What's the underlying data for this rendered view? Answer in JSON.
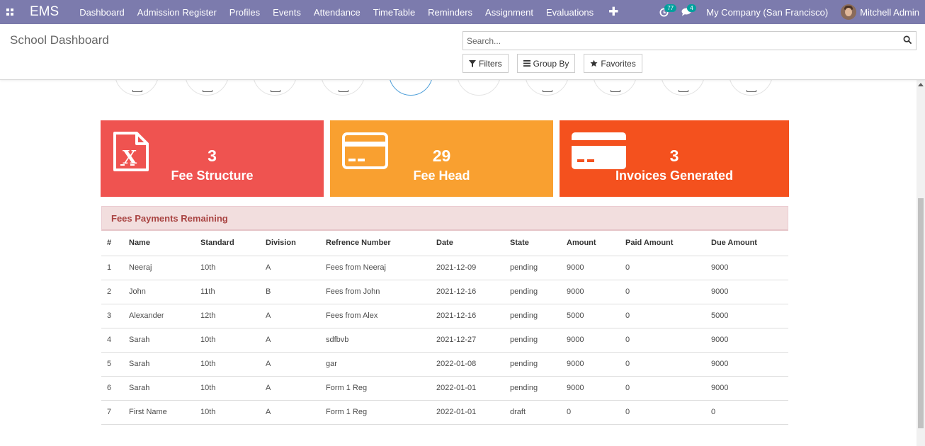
{
  "navbar": {
    "brand": "EMS",
    "menu": [
      "Dashboard",
      "Admission Register",
      "Profiles",
      "Events",
      "Attendance",
      "TimeTable",
      "Reminders",
      "Assignment",
      "Evaluations"
    ],
    "activity_count": "77",
    "message_count": "4",
    "company": "My Company (San Francisco)",
    "user": "Mitchell Admin"
  },
  "control": {
    "title": "School Dashboard",
    "search_placeholder": "Search...",
    "filters_label": "Filters",
    "group_by_label": "Group By",
    "favorites_label": "Favorites"
  },
  "cards": [
    {
      "value": "3",
      "label": "Fee Structure",
      "color": "#ef5350",
      "icon": "file-excel-icon"
    },
    {
      "value": "29",
      "label": "Fee Head",
      "color": "#f9a030",
      "icon": "credit-card-outline-icon"
    },
    {
      "value": "3",
      "label": "Invoices Generated",
      "color": "#f4511e",
      "icon": "credit-card-icon"
    }
  ],
  "fees_table": {
    "title": "Fees Payments Remaining",
    "columns": [
      "#",
      "Name",
      "Standard",
      "Division",
      "Refrence Number",
      "Date",
      "State",
      "Amount",
      "Paid Amount",
      "Due Amount"
    ],
    "rows": [
      [
        "1",
        "Neeraj",
        "10th",
        "A",
        "Fees from Neeraj",
        "2021-12-09",
        "pending",
        "9000",
        "0",
        "9000"
      ],
      [
        "2",
        "John",
        "11th",
        "B",
        "Fees from John",
        "2021-12-16",
        "pending",
        "9000",
        "0",
        "9000"
      ],
      [
        "3",
        "Alexander",
        "12th",
        "A",
        "Fees from Alex",
        "2021-12-16",
        "pending",
        "5000",
        "0",
        "5000"
      ],
      [
        "4",
        "Sarah",
        "10th",
        "A",
        "sdfbvb",
        "2021-12-27",
        "pending",
        "9000",
        "0",
        "9000"
      ],
      [
        "5",
        "Sarah",
        "10th",
        "A",
        "gar",
        "2022-01-08",
        "pending",
        "9000",
        "0",
        "9000"
      ],
      [
        "6",
        "Sarah",
        "10th",
        "A",
        "Form 1 Reg",
        "2022-01-01",
        "pending",
        "9000",
        "0",
        "9000"
      ],
      [
        "7",
        "First Name",
        "10th",
        "A",
        "Form 1 Reg",
        "2022-01-01",
        "draft",
        "0",
        "0",
        "0"
      ]
    ]
  }
}
